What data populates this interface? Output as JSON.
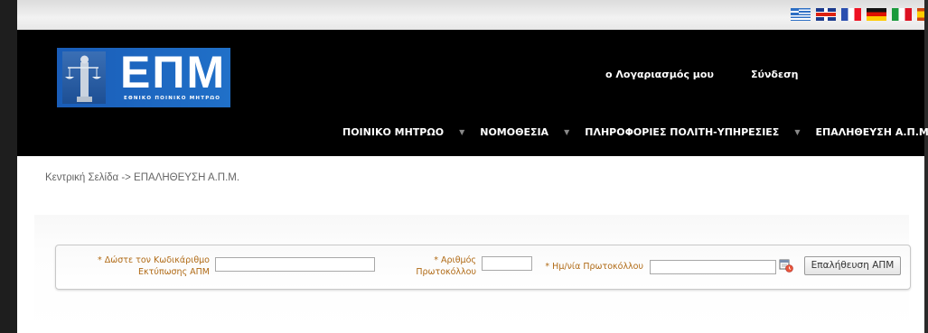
{
  "flags": [
    "greek-flag-icon",
    "uk-flag-icon",
    "french-flag-icon",
    "german-flag-icon",
    "italian-flag-icon",
    "spanish-flag-icon"
  ],
  "header": {
    "logo_text": "ΕΠΜ",
    "logo_subtitle": "ΕΘΝΙΚΟ ΠΟΙΝΙΚΟ ΜΗΤΡΩΟ",
    "account_label": "ο Λογαριασμός μου",
    "login_label": "Σύνδεση"
  },
  "nav": {
    "items": [
      "ΠΟΙΝΙΚΟ ΜΗΤΡΩΟ",
      "ΝΟΜΟΘΕΣΙΑ",
      "ΠΛΗΡΟΦΟΡΙΕΣ ΠΟΛΙΤΗ-ΥΠΗΡΕΣΙΕΣ",
      "ΕΠΑΛΗΘΕΥΣΗ Α.Π.Μ."
    ],
    "separator": "▼"
  },
  "breadcrumb": "Κεντρική Σελίδα -> ΕΠΑΛΗΘΕΥΣΗ Α.Π.Μ.",
  "form": {
    "code_label_line1": "* Δώστε τον Κωδικάριθμο",
    "code_label_line2": "Εκτύπωσης ΑΠΜ",
    "code_value": "",
    "protocol_label_line1": "* Αριθμός",
    "protocol_label_line2": "Πρωτοκόλλου",
    "protocol_value": "",
    "date_label": "* Ημ/νία Πρωτοκόλλου",
    "date_value": "",
    "verify_button": "Επαλήθευση ΑΠΜ"
  },
  "colors": {
    "header_bg": "#000000",
    "logo_bg": "#1a5db8",
    "label_color": "#b06a15"
  }
}
